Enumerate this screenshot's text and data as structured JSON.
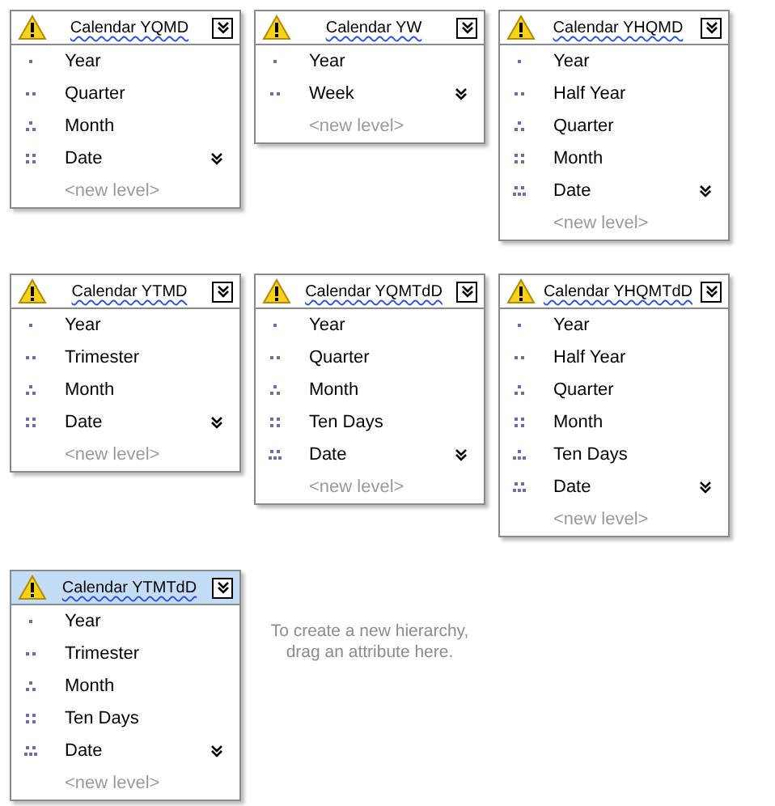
{
  "hierarchies": [
    {
      "title": "Calendar YQMD",
      "selected": false,
      "levels": [
        "Year",
        "Quarter",
        "Month",
        "Date"
      ],
      "new_level": "<new level>"
    },
    {
      "title": "Calendar YW",
      "selected": false,
      "levels": [
        "Year",
        "Week"
      ],
      "new_level": "<new level>"
    },
    {
      "title": "Calendar YHQMD",
      "selected": false,
      "levels": [
        "Year",
        "Half Year",
        "Quarter",
        "Month",
        "Date"
      ],
      "new_level": "<new level>"
    },
    {
      "title": "Calendar YTMD",
      "selected": false,
      "levels": [
        "Year",
        "Trimester",
        "Month",
        "Date"
      ],
      "new_level": "<new level>"
    },
    {
      "title": "Calendar YQMTdD",
      "selected": false,
      "levels": [
        "Year",
        "Quarter",
        "Month",
        "Ten Days",
        "Date"
      ],
      "new_level": "<new level>"
    },
    {
      "title": "Calendar YHQMTdD",
      "selected": false,
      "levels": [
        "Year",
        "Half Year",
        "Quarter",
        "Month",
        "Ten Days",
        "Date"
      ],
      "new_level": "<new level>"
    },
    {
      "title": "Calendar YTMTdD",
      "selected": true,
      "levels": [
        "Year",
        "Trimester",
        "Month",
        "Ten Days",
        "Date"
      ],
      "new_level": "<new level>"
    }
  ],
  "drop_hint": "To create a new hierarchy, drag an attribute here."
}
